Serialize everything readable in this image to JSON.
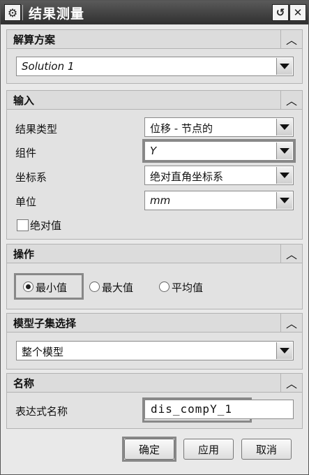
{
  "window": {
    "title": "结果测量"
  },
  "sections": {
    "solution": {
      "header": "解算方案",
      "dropdown_value": "Solution 1"
    },
    "input": {
      "header": "输入",
      "result_type": {
        "label": "结果类型",
        "value": "位移 - 节点的"
      },
      "component": {
        "label": "组件",
        "value": "Y"
      },
      "coord_system": {
        "label": "坐标系",
        "value": "绝对直角坐标系"
      },
      "unit": {
        "label": "单位",
        "value": "mm"
      },
      "absolute_value": {
        "label": "绝对值",
        "checked": false
      }
    },
    "operation": {
      "header": "操作",
      "options": [
        "最小值",
        "最大值",
        "平均值"
      ],
      "selected": "最小值"
    },
    "model_subset": {
      "header": "模型子集选择",
      "dropdown_value": "整个模型"
    },
    "name": {
      "header": "名称",
      "expr_label": "表达式名称",
      "expr_value": "dis_compY_1"
    }
  },
  "buttons": {
    "ok": "确定",
    "apply": "应用",
    "cancel": "取消"
  },
  "icons": {
    "gear": "gear-icon",
    "reset": "reset-icon",
    "close": "close-icon",
    "collapse": "chevron-up-icon"
  }
}
